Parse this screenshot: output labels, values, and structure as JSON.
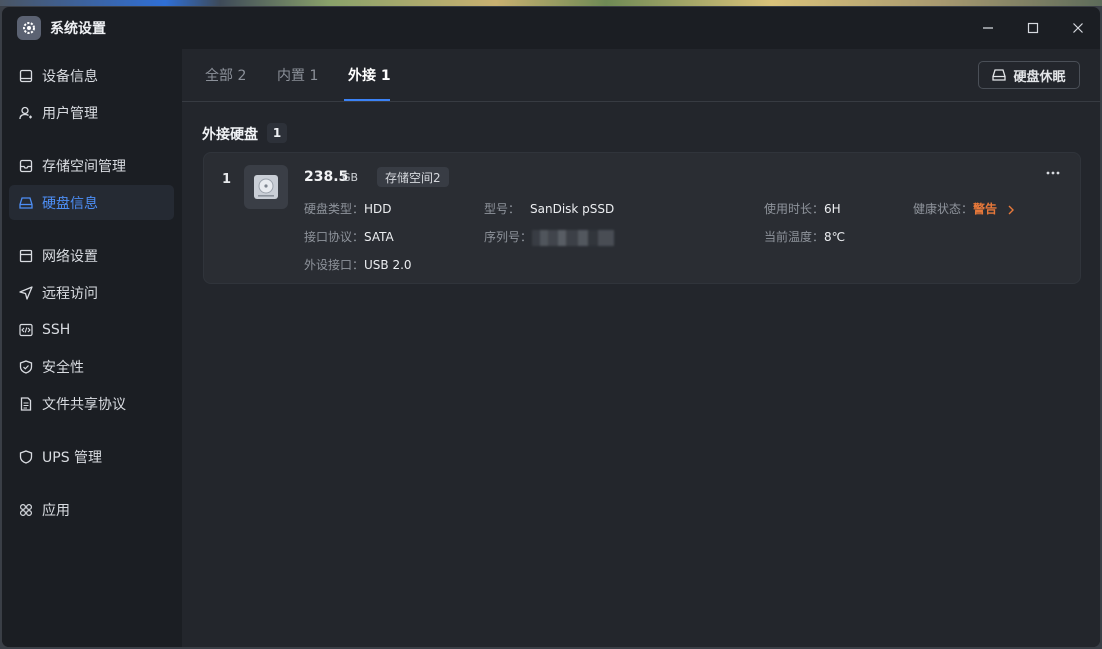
{
  "app": {
    "title": "系统设置",
    "icon": "gear-icon"
  },
  "window_controls": [
    "minimize-icon",
    "maximize-icon",
    "close-icon"
  ],
  "sidebar": {
    "items": [
      {
        "label": "设备信息",
        "icon": "device-icon"
      },
      {
        "label": "用户管理",
        "icon": "user-icon"
      },
      {
        "label": "存储空间管理",
        "icon": "storage-icon"
      },
      {
        "label": "硬盘信息",
        "icon": "disk-icon",
        "active": true
      },
      {
        "label": "网络设置",
        "icon": "network-icon"
      },
      {
        "label": "远程访问",
        "icon": "send-icon"
      },
      {
        "label": "SSH",
        "icon": "code-icon"
      },
      {
        "label": "安全性",
        "icon": "shield-check-icon"
      },
      {
        "label": "文件共享协议",
        "icon": "document-icon"
      },
      {
        "label": "UPS 管理",
        "icon": "shield-icon"
      },
      {
        "label": "应用",
        "icon": "apps-icon"
      }
    ]
  },
  "tabs": [
    {
      "label": "全部 2"
    },
    {
      "label": "内置 1"
    },
    {
      "label": "外接 1",
      "active": true
    }
  ],
  "sleep_button": {
    "label": "硬盘休眠",
    "icon": "disk-icon"
  },
  "section": {
    "title": "外接硬盘",
    "count": "1"
  },
  "disk": {
    "index": "1",
    "capacity": "238.5",
    "unit": "GB",
    "pool": "存储空间2",
    "type_label": "硬盘类型：",
    "type_value": "HDD",
    "interface_label": "接口协议：",
    "interface_value": "SATA",
    "port_label": "外设接口：",
    "port_value": "USB 2.0",
    "model_label": "型号：",
    "model_value": "SanDisk pSSD",
    "serial_label": "序列号：",
    "uptime_label": "使用时长：",
    "uptime_value": "6H",
    "temp_label": "当前温度：",
    "temp_value": "8℃",
    "health_label": "健康状态：",
    "health_value": "警告",
    "warning_color": "#e6783a"
  },
  "colors": {
    "accent": "#3b82f6",
    "background": "#1b1e23",
    "panel": "#23262c",
    "card": "#2a2d33"
  }
}
